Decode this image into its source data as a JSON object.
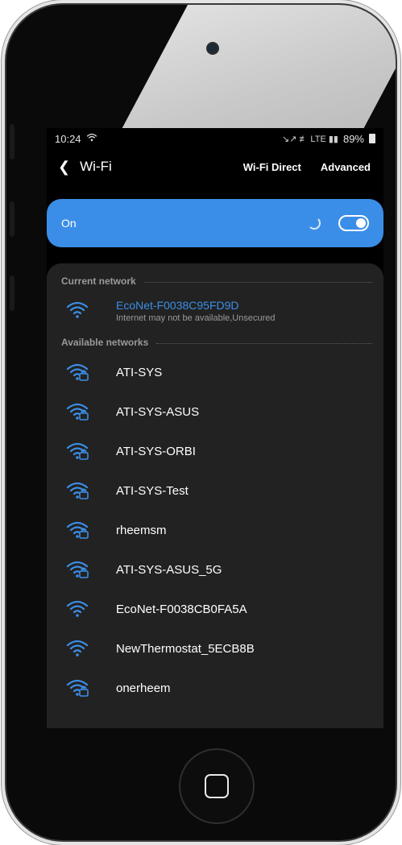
{
  "statusbar": {
    "time": "10:24",
    "battery_pct": "89%",
    "signal_text": "↘↗ ≢ LTE ▮▮"
  },
  "titlebar": {
    "title": "Wi-Fi",
    "wifi_direct_label": "Wi-Fi Direct",
    "advanced_label": "Advanced"
  },
  "toggle": {
    "label": "On",
    "state": "on"
  },
  "sections": {
    "current_label": "Current network",
    "available_label": "Available networks"
  },
  "current_network": {
    "name": "EcoNet-F0038C95FD9D",
    "status": "Internet may not be available,Unsecured",
    "icon": "wifi-icon",
    "secured": false
  },
  "available_networks": [
    {
      "name": "ATI-SYS",
      "icon": "wifi-lock-icon",
      "secured": true
    },
    {
      "name": "ATI-SYS-ASUS",
      "icon": "wifi-lock-icon",
      "secured": true
    },
    {
      "name": "ATI-SYS-ORBI",
      "icon": "wifi-lock-icon",
      "secured": true
    },
    {
      "name": "ATI-SYS-Test",
      "icon": "wifi-lock-icon",
      "secured": true
    },
    {
      "name": "rheemsm",
      "icon": "wifi-lock-icon",
      "secured": true
    },
    {
      "name": "ATI-SYS-ASUS_5G",
      "icon": "wifi-lock-icon",
      "secured": true
    },
    {
      "name": "EcoNet-F0038CB0FA5A",
      "icon": "wifi-icon",
      "secured": false
    },
    {
      "name": "NewThermostat_5ECB8B",
      "icon": "wifi-icon",
      "secured": false
    },
    {
      "name": "onerheem",
      "icon": "wifi-lock-icon",
      "secured": true
    }
  ],
  "colors": {
    "accent": "#3b8ee7",
    "background": "#000000",
    "card": "#222222",
    "secondary_text": "#9a9a9a"
  }
}
